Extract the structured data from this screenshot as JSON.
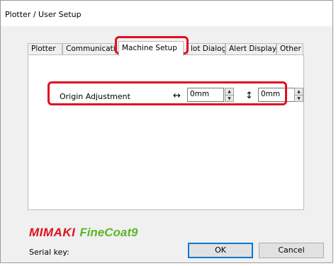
{
  "window": {
    "title": "Plotter / User Setup"
  },
  "tabs": [
    {
      "label": "Plotter"
    },
    {
      "label": "Communicatio"
    },
    {
      "label": "Machine Setup"
    },
    {
      "label": "lot Dialog"
    },
    {
      "label": "Alert Display"
    },
    {
      "label": "Other"
    }
  ],
  "origin": {
    "label": "Origin Adjustment",
    "horizontal_icon": "↔",
    "horizontal_value": "0mm",
    "vertical_icon": "↕",
    "vertical_value": "0mm"
  },
  "branding": {
    "mimaki": "MIMAKI",
    "product": "FineCoat9"
  },
  "footer": {
    "serial_label": "Serial key:",
    "ok_label": "OK",
    "cancel_label": "Cancel"
  },
  "colors": {
    "highlight": "#e0101e",
    "mimaki_red": "#e0101e",
    "finecoat_green": "#5fb52a"
  }
}
